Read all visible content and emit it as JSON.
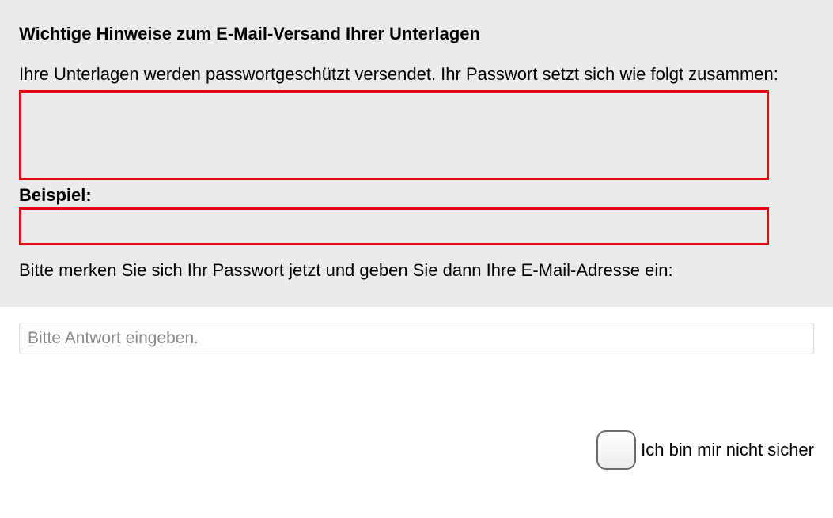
{
  "info": {
    "heading": "Wichtige Hinweise zum E-Mail-Versand Ihrer Unterlagen",
    "intro": "Ihre Unterlagen werden passwortgeschützt versendet. Ihr Passwort setzt sich wie folgt zusammen:",
    "example_label": "Beispiel:",
    "instruction": "Bitte merken Sie sich Ihr Passwort jetzt und geben Sie dann Ihre E-Mail-Adresse ein:"
  },
  "answer": {
    "placeholder": "Bitte Antwort eingeben."
  },
  "unsure": {
    "label": "Ich bin mir nicht sicher"
  }
}
